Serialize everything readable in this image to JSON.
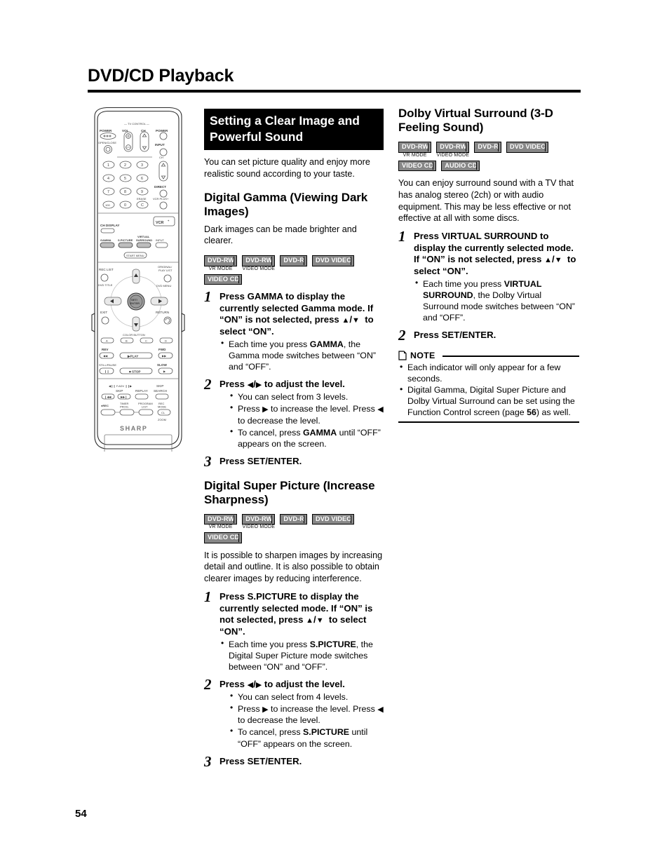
{
  "header": {
    "title": "DVD/CD Playback"
  },
  "page_number": "54",
  "middle": {
    "banner": "Setting a Clear Image and Powerful Sound",
    "intro": "You can set picture quality and enjoy more realistic sound according to your taste.",
    "gamma": {
      "heading": "Digital Gamma (Viewing Dark Images)",
      "intro": "Dark images can be made brighter and clearer.",
      "badges": [
        [
          {
            "label": "DVD-RW",
            "sub": "VR MODE"
          },
          {
            "label": "DVD-RW",
            "sub": "VIDEO MODE"
          },
          {
            "label": "DVD-R",
            "sub": ""
          },
          {
            "label": "DVD VIDEO",
            "sub": ""
          }
        ],
        [
          {
            "label": "VIDEO CD",
            "sub": ""
          }
        ]
      ],
      "steps": [
        {
          "num": "1",
          "lead_html": "Press <b class=\"kw\">GAMMA</b> to display the currently selected Gamma mode. If “ON” is not selected, press <span class=\"arrow\">▲</span>/<span class=\"arrow\">▼</span>&nbsp; to select “ON”.",
          "bullets": [
            "Each time you press <b class=\"kw\">GAMMA</b>, the Gamma mode switches between “ON” and “OFF”."
          ],
          "bullets_indent": false
        },
        {
          "num": "2",
          "lead_html": "Press <span class=\"arrow\">◀</span>/<span class=\"arrow\">▶</span> to adjust the level.",
          "bullets": [
            "You can select from 3 levels.",
            "Press <span class=\"arrow\">▶</span> to increase the level. Press <span class=\"arrow\">◀</span> to decrease the level.",
            "To cancel, press <b class=\"kw\">GAMMA</b> until “OFF” appears on the screen."
          ],
          "bullets_indent": true
        },
        {
          "num": "3",
          "lead_html": "Press <b class=\"kw\">SET/ENTER.</b>",
          "bullets": [],
          "bullets_indent": false
        }
      ]
    },
    "super_picture": {
      "heading": "Digital Super Picture (Increase Sharpness)",
      "intro": "It is possible to sharpen images by increasing detail and outline. It is also possible to obtain clearer images by reducing interference.",
      "badges": [
        [
          {
            "label": "DVD-RW",
            "sub": "VR MODE"
          },
          {
            "label": "DVD-RW",
            "sub": "VIDEO MODE"
          },
          {
            "label": "DVD-R",
            "sub": ""
          },
          {
            "label": "DVD VIDEO",
            "sub": ""
          }
        ],
        [
          {
            "label": "VIDEO CD",
            "sub": ""
          }
        ]
      ],
      "steps": [
        {
          "num": "1",
          "lead_html": "Press <b class=\"kw\">S.PICTURE</b> to display the currently selected mode. If “ON” is not selected, press <span class=\"arrow\">▲</span>/<span class=\"arrow\">▼</span>&nbsp; to select “ON”.",
          "bullets": [
            "Each time you press <b class=\"kw\">S.PICTURE</b>, the Digital Super Picture mode switches between “ON” and “OFF”."
          ],
          "bullets_indent": false
        },
        {
          "num": "2",
          "lead_html": "Press <span class=\"arrow\">◀</span>/<span class=\"arrow\">▶</span> to adjust the level.",
          "bullets": [
            "You can select from 4 levels.",
            "Press <span class=\"arrow\">▶</span> to increase the level. Press <span class=\"arrow\">◀</span> to decrease the level.",
            "To cancel, press <b class=\"kw\">S.PICTURE</b> until “OFF” appears on the screen."
          ],
          "bullets_indent": true
        },
        {
          "num": "3",
          "lead_html": "Press <b class=\"kw\">SET/ENTER.</b>",
          "bullets": [],
          "bullets_indent": false
        }
      ]
    }
  },
  "right": {
    "surround": {
      "heading": "Dolby Virtual Surround (3-D Feeling Sound)",
      "intro": "You can enjoy surround sound with a TV that has analog stereo (2ch) or with audio equipment. This may be less effective or not effective at all with some discs.",
      "badges": [
        [
          {
            "label": "DVD-RW",
            "sub": "VR MODE"
          },
          {
            "label": "DVD-RW",
            "sub": "VIDEO MODE"
          },
          {
            "label": "DVD-R",
            "sub": ""
          },
          {
            "label": "DVD VIDEO",
            "sub": ""
          }
        ],
        [
          {
            "label": "VIDEO CD",
            "sub": ""
          },
          {
            "label": "AUDIO CD",
            "sub": ""
          }
        ]
      ],
      "steps": [
        {
          "num": "1",
          "lead_html": "Press <b class=\"kw\">VIRTUAL SURROUND</b> to display the currently selected mode. If “ON” is not selected, press <span class=\"arrow\">▲</span>/<span class=\"arrow\">▼</span>&nbsp; to select “ON”.",
          "bullets": [
            "Each time you press <b class=\"kw\">VIRTUAL SURROUND</b>, the Dolby Virtual Surround mode switches between “ON” and “OFF”."
          ],
          "bullets_indent": false
        },
        {
          "num": "2",
          "lead_html": "Press <b class=\"kw\">SET/ENTER.</b>",
          "bullets": [],
          "bullets_indent": false
        }
      ]
    },
    "note": {
      "label": "NOTE",
      "items": [
        "Each indicator will only appear for a few seconds.",
        "Digital Gamma, Digital Super Picture and Dolby Virtual Surround can be set using the Function Control screen (page <b class=\"kw\">56</b>) as well."
      ]
    }
  },
  "remote": {
    "brand": "SHARP",
    "labels": {
      "tv_control": "— TV CONTROL —",
      "power_left": "POWER",
      "vol": "VOL",
      "ch_top": "CH",
      "power_right": "POWER",
      "open_close": "OPEN/CLOSE",
      "input_top": "INPUT",
      "ch_right": "CH",
      "direct": "DIRECT",
      "erase": "ERASE",
      "vcrplus": "VCR PLUS+",
      "ch_display": "CH DISPLAY",
      "gamma": "GAMMA",
      "s_picture": "S.PICTURE",
      "virtual_surround": "VIRTUAL SURROUND",
      "input2": "INPUT",
      "start_menu": "START MENU",
      "rec_list": "REC LIST",
      "dvd_title": "DVD TITLE",
      "original_play_list": "ORIGINAL/ PLAY LIST",
      "dvd_menu": "DVD MENU",
      "set_enter": "SET/ ENTER",
      "exit": "EXIT",
      "return": "RETURN",
      "color_button": "COLOR BUTTON",
      "a": "A",
      "b": "B",
      "c": "C",
      "d": "D",
      "rev": "REV",
      "fwd": "FWD",
      "play": "PLAY",
      "still_pause": "STILL/PAUSE",
      "slow": "SLOW",
      "stop": "STOP",
      "f_adv": "F.ADV",
      "skip": "SKIP",
      "replay": "REPLAY",
      "skip_search": "SKIP SEARCH",
      "rec": "REC",
      "timer_prog": "TIMER PROG.",
      "program_list": "PROGRAM LIST",
      "rec_mode": "REC MODE",
      "zoom": "ZOOM",
      "cl": "CL",
      "vcr_logo": "VCR",
      "num_1": "1",
      "num_2": "2",
      "num_3": "3",
      "num_4": "4",
      "num_5": "5",
      "num_6": "6",
      "num_7": "7",
      "num_8": "8",
      "num_9": "9",
      "num_100": "100",
      "num_0": "0",
      "num_c": "C"
    }
  }
}
